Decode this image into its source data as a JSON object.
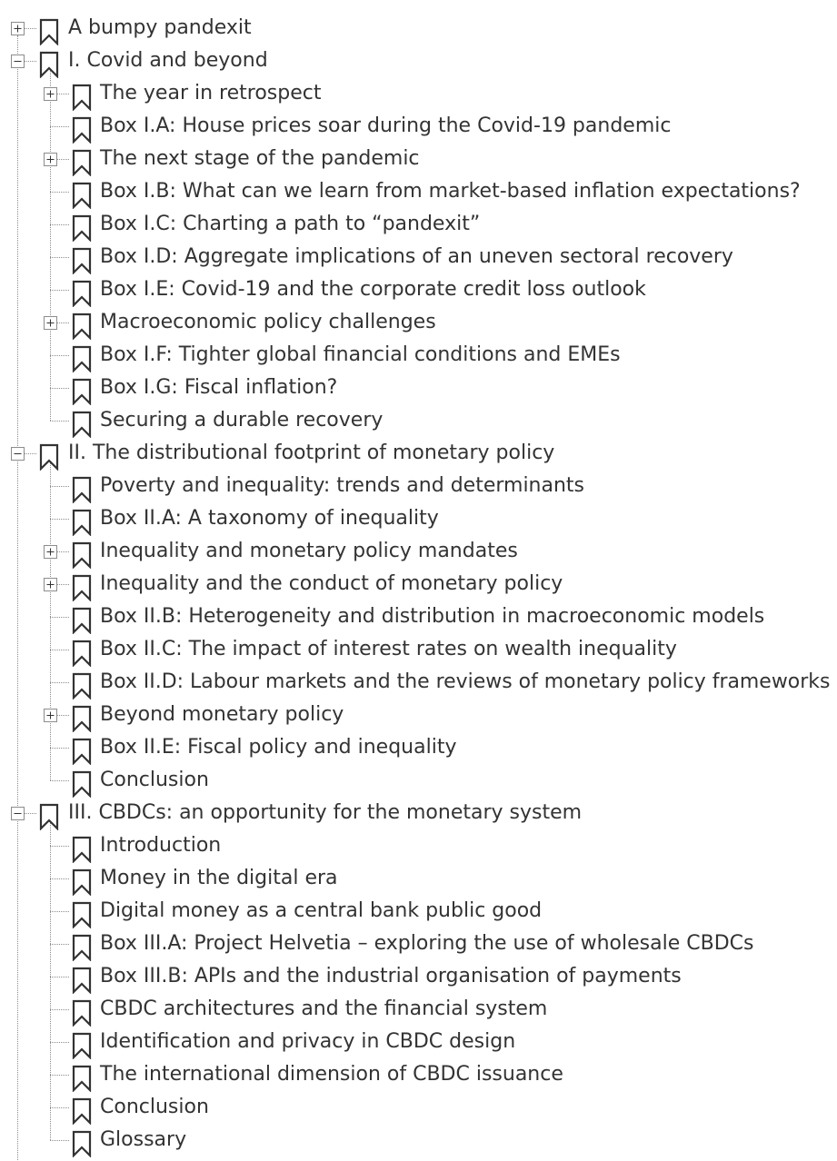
{
  "bookmarks": [
    {
      "level": 0,
      "label": "A bumpy pandexit",
      "toggle": "collapsed"
    },
    {
      "level": 0,
      "label": "I. Covid and beyond",
      "toggle": "expanded"
    },
    {
      "level": 1,
      "label": "The year in retrospect",
      "toggle": "collapsed"
    },
    {
      "level": 1,
      "label": "Box I.A: House prices soar during the Covid-19 pandemic",
      "toggle": "none"
    },
    {
      "level": 1,
      "label": "The next stage of the pandemic",
      "toggle": "collapsed"
    },
    {
      "level": 1,
      "label": "Box I.B: What can we learn from market-based inflation expectations?",
      "toggle": "none"
    },
    {
      "level": 1,
      "label": "Box I.C: Charting a path to “pandexit”",
      "toggle": "none"
    },
    {
      "level": 1,
      "label": "Box I.D: Aggregate implications of an uneven sectoral recovery",
      "toggle": "none"
    },
    {
      "level": 1,
      "label": "Box I.E: Covid-19 and the corporate credit loss outlook",
      "toggle": "none"
    },
    {
      "level": 1,
      "label": "Macroeconomic policy challenges",
      "toggle": "collapsed"
    },
    {
      "level": 1,
      "label": "Box I.F: Tighter global financial conditions and EMEs",
      "toggle": "none"
    },
    {
      "level": 1,
      "label": "Box I.G: Fiscal inflation?",
      "toggle": "none"
    },
    {
      "level": 1,
      "label": "Securing a durable recovery",
      "toggle": "none"
    },
    {
      "level": 0,
      "label": "II. The distributional footprint of monetary policy",
      "toggle": "expanded"
    },
    {
      "level": 1,
      "label": "Poverty and inequality: trends and determinants",
      "toggle": "none"
    },
    {
      "level": 1,
      "label": "Box II.A: A taxonomy of inequality",
      "toggle": "none"
    },
    {
      "level": 1,
      "label": "Inequality and monetary policy mandates",
      "toggle": "collapsed"
    },
    {
      "level": 1,
      "label": "Inequality and the conduct of monetary policy",
      "toggle": "collapsed"
    },
    {
      "level": 1,
      "label": "Box II.B: Heterogeneity and distribution in macroeconomic models",
      "toggle": "none"
    },
    {
      "level": 1,
      "label": "Box II.C: The impact of interest rates on wealth inequality",
      "toggle": "none"
    },
    {
      "level": 1,
      "label": "Box II.D: Labour markets and the reviews of monetary policy frameworks",
      "toggle": "none"
    },
    {
      "level": 1,
      "label": "Beyond monetary policy",
      "toggle": "collapsed"
    },
    {
      "level": 1,
      "label": "Box II.E: Fiscal policy and inequality",
      "toggle": "none"
    },
    {
      "level": 1,
      "label": "Conclusion",
      "toggle": "none"
    },
    {
      "level": 0,
      "label": "III. CBDCs: an opportunity for the monetary system",
      "toggle": "expanded"
    },
    {
      "level": 1,
      "label": "Introduction",
      "toggle": "none"
    },
    {
      "level": 1,
      "label": "Money in the digital era",
      "toggle": "none"
    },
    {
      "level": 1,
      "label": "Digital money as a central bank public good",
      "toggle": "none"
    },
    {
      "level": 1,
      "label": "Box III.A: Project Helvetia – exploring the use of wholesale CBDCs",
      "toggle": "none"
    },
    {
      "level": 1,
      "label": "Box III.B: APIs and the industrial organisation of payments",
      "toggle": "none"
    },
    {
      "level": 1,
      "label": "CBDC architectures and the financial system",
      "toggle": "none"
    },
    {
      "level": 1,
      "label": "Identification and privacy in CBDC design",
      "toggle": "none"
    },
    {
      "level": 1,
      "label": "The international dimension of CBDC issuance",
      "toggle": "none"
    },
    {
      "level": 1,
      "label": "Conclusion",
      "toggle": "none"
    },
    {
      "level": 1,
      "label": "Glossary",
      "toggle": "none"
    }
  ],
  "icons": {
    "bookmark": "bookmark-icon",
    "expand": "expand-plus-icon",
    "collapse": "collapse-minus-icon"
  },
  "colors": {
    "text": "#333333",
    "icon_stroke": "#333333",
    "tree_lines": "#8c8c8c",
    "toggle_border": "#8c8c8c",
    "background": "#ffffff"
  }
}
